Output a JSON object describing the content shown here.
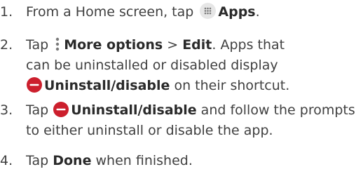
{
  "steps": [
    {
      "number": "1.",
      "text_before": "From a Home screen, tap",
      "icon": "apps-icon",
      "bold": "Apps",
      "text_after": "."
    },
    {
      "number": "2.",
      "text_before": "Tap",
      "icon": "more-options-icon",
      "bold1": "More options",
      "separator": " > ",
      "bold2": "Edit",
      "text_after": ". Apps that",
      "line2": "can be uninstalled or disabled display",
      "icon2": "remove-icon",
      "bold3": "Uninstall/disable",
      "line3_after": " on their shortcut."
    },
    {
      "number": "3.",
      "text_before": "Tap",
      "icon": "remove-icon",
      "bold": "Uninstall/disable",
      "text_after": " and follow the prompts",
      "line2": "to either uninstall or disable the app."
    },
    {
      "number": "4.",
      "text_before": "Tap ",
      "bold": "Done",
      "text_after": " when finished."
    }
  ],
  "colors": {
    "text": "#404040",
    "remove_icon": "#cc1f2d",
    "icon_bg": "#e6e6e6",
    "icon_fg": "#7a7a7a"
  }
}
